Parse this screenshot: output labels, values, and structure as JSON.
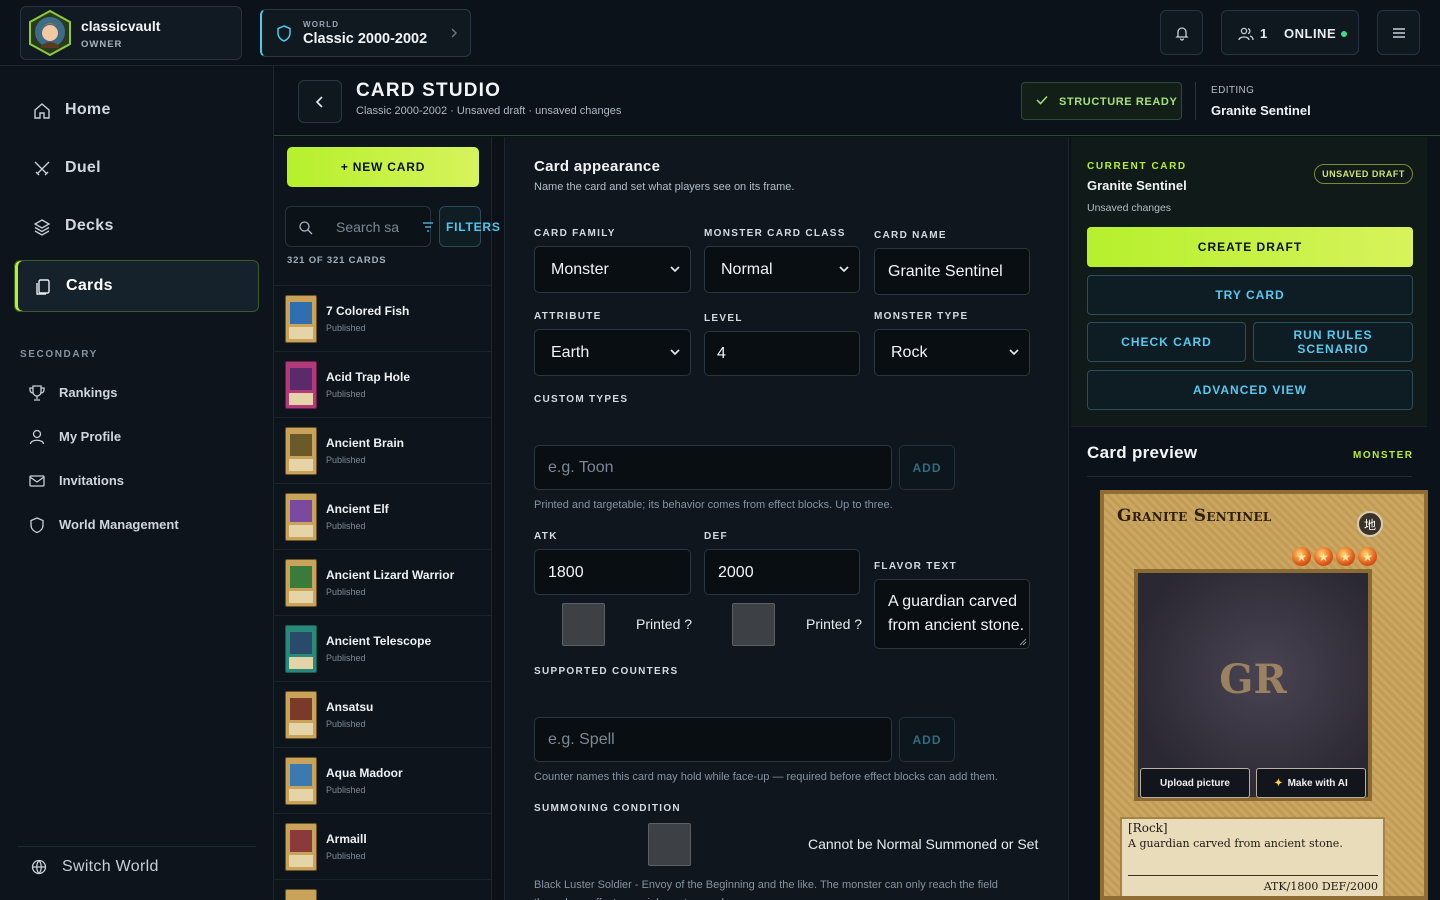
{
  "topbar": {
    "username": "classicvault",
    "role": "OWNER",
    "world_label": "WORLD",
    "world_name": "Classic 2000-2002",
    "online_count": "1",
    "online_label": "ONLINE"
  },
  "sidebar": {
    "primary": [
      {
        "label": "Home",
        "icon": "home-icon"
      },
      {
        "label": "Duel",
        "icon": "swords-icon"
      },
      {
        "label": "Decks",
        "icon": "layers-icon"
      },
      {
        "label": "Cards",
        "icon": "cards-icon",
        "active": true
      }
    ],
    "secondary_label": "SECONDARY",
    "secondary": [
      {
        "label": "Rankings",
        "icon": "trophy-icon"
      },
      {
        "label": "My Profile",
        "icon": "user-icon"
      },
      {
        "label": "Invitations",
        "icon": "mail-icon"
      },
      {
        "label": "World Management",
        "icon": "shield-icon"
      }
    ],
    "switch_world": "Switch World"
  },
  "header": {
    "title": "CARD STUDIO",
    "subtitle": "Classic 2000-2002 · Unsaved draft · unsaved changes",
    "status_badge": "STRUCTURE READY",
    "editing_label": "EDITING",
    "editing_name": "Granite Sentinel"
  },
  "list": {
    "new_card": "+ NEW CARD",
    "search_placeholder": "Search sa",
    "filters": "FILTERS",
    "count": "321 OF 321 CARDS",
    "cards": [
      {
        "name": "7 Colored Fish",
        "status": "Published",
        "color": "#2f6fb0"
      },
      {
        "name": "Acid Trap Hole",
        "status": "Published",
        "color": "#b03a7a"
      },
      {
        "name": "Ancient Brain",
        "status": "Published",
        "color": "#6a5a2a"
      },
      {
        "name": "Ancient Elf",
        "status": "Published",
        "color": "#7a4aa0"
      },
      {
        "name": "Ancient Lizard Warrior",
        "status": "Published",
        "color": "#3a7a3a"
      },
      {
        "name": "Ancient Telescope",
        "status": "Published",
        "color": "#2a8a8a"
      },
      {
        "name": "Ansatsu",
        "status": "Published",
        "color": "#7a3a2a"
      },
      {
        "name": "Aqua Madoor",
        "status": "Published",
        "color": "#3a7ab0"
      },
      {
        "name": "Armaill",
        "status": "Published",
        "color": "#8a3a3a"
      }
    ]
  },
  "form": {
    "title": "Card appearance",
    "subtitle": "Name the card and set what players see on its frame.",
    "card_family_label": "CARD FAMILY",
    "card_family": "Monster",
    "monster_class_label": "MONSTER CARD CLASS",
    "monster_class": "Normal",
    "card_name_label": "CARD NAME",
    "card_name": "Granite Sentinel",
    "attribute_label": "ATTRIBUTE",
    "attribute": "Earth",
    "level_label": "LEVEL",
    "level": "4",
    "monster_type_label": "MONSTER TYPE",
    "monster_type": "Rock",
    "custom_types_label": "CUSTOM TYPES",
    "custom_types_placeholder": "e.g. Toon",
    "add": "ADD",
    "custom_types_hint": "Printed and targetable; its behavior comes from effect blocks. Up to three.",
    "atk_label": "ATK",
    "atk": "1800",
    "def_label": "DEF",
    "def": "2000",
    "printed_q": "Printed ?",
    "flavor_label": "FLAVOR TEXT",
    "flavor": "A guardian carved from ancient stone.",
    "counters_label": "SUPPORTED COUNTERS",
    "counters_placeholder": "e.g. Spell",
    "counters_hint": "Counter names this card may hold while face-up — required before effect blocks can add them.",
    "summon_label": "SUMMONING CONDITION",
    "summon_option": "Cannot be Normal Summoned or Set",
    "summon_hint": "Black Luster Soldier - Envoy of the Beginning and the like. The monster can only reach the field through an effect or an inherent procedure."
  },
  "right": {
    "current_label": "CURRENT CARD",
    "current_name": "Granite Sentinel",
    "current_status": "Unsaved changes",
    "badge": "UNSAVED DRAFT",
    "create_draft": "CREATE DRAFT",
    "try_card": "TRY CARD",
    "check_card": "CHECK CARD",
    "run_rules": "RUN RULES SCENARIO",
    "advanced": "ADVANCED VIEW",
    "preview_title": "Card preview",
    "preview_tag": "MONSTER"
  },
  "preview_card": {
    "name": "Granite Sentinel",
    "attribute_glyph": "地",
    "level": 4,
    "art_initials": "GR",
    "upload": "Upload picture",
    "make_ai": "Make with AI",
    "type_line": "[Rock]",
    "flavor": "A guardian carved from ancient stone.",
    "stats": "ATK/1800   DEF/2000"
  }
}
